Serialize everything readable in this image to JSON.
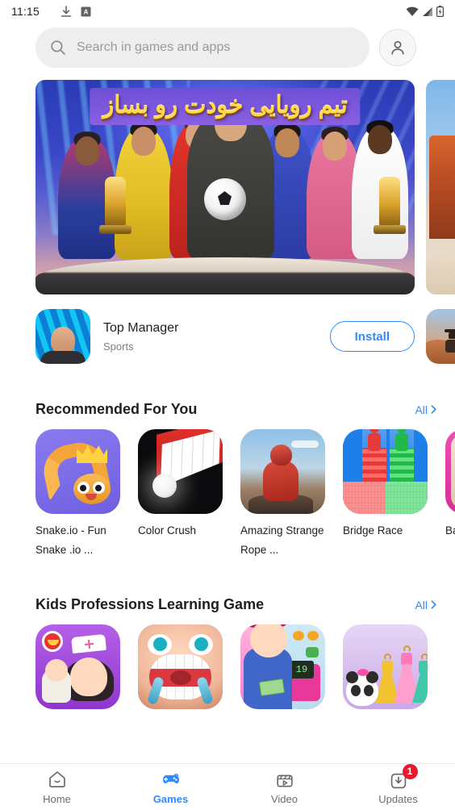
{
  "status_bar": {
    "time": "11:15",
    "left_icons": [
      "download-icon",
      "app-badge-icon"
    ],
    "right_icons": [
      "wifi-icon",
      "signal-icon",
      "battery-icon"
    ]
  },
  "search": {
    "placeholder": "Search in games and apps",
    "icon": "search-icon",
    "avatar_icon": "account-icon"
  },
  "banners": [
    {
      "title": "تیم رویایی خودت رو بساز",
      "theme": "football-dream-team"
    },
    {
      "title": "",
      "theme": "western-canyon"
    }
  ],
  "featured": {
    "icon": "top-manager-icon",
    "title": "Top Manager",
    "category": "Sports",
    "install_label": "Install",
    "peek_icon": "western-game-icon"
  },
  "sections": [
    {
      "title": "Recommended For You",
      "all_label": "All",
      "chevron": "chevron-right-icon",
      "apps": [
        {
          "name": "Snake.io - Fun Snake .io ...",
          "icon": "snake-io-icon"
        },
        {
          "name": "Color Crush",
          "icon": "color-crush-icon"
        },
        {
          "name": "Amazing Strange Rope ...",
          "icon": "amazing-strange-rope-icon"
        },
        {
          "name": "Bridge Race",
          "icon": "bridge-race-icon"
        },
        {
          "name": "Baghali",
          "icon": "baghali-icon"
        }
      ]
    },
    {
      "title": "Kids Professions Learning Game",
      "all_label": "All",
      "chevron": "chevron-right-icon",
      "apps": [
        {
          "name": "",
          "icon": "baby-nurse-icon"
        },
        {
          "name": "",
          "icon": "kids-dentist-icon"
        },
        {
          "name": "",
          "icon": "supermarket-girl-icon"
        },
        {
          "name": "",
          "icon": "panda-dress-up-icon"
        }
      ]
    }
  ],
  "bottom_nav": {
    "items": [
      {
        "label": "Home",
        "icon": "home-icon",
        "active": false,
        "badge": ""
      },
      {
        "label": "Games",
        "icon": "gamepad-icon",
        "active": true,
        "badge": ""
      },
      {
        "label": "Video",
        "icon": "video-icon",
        "active": false,
        "badge": ""
      },
      {
        "label": "Updates",
        "icon": "download-box-icon",
        "active": false,
        "badge": "1"
      }
    ]
  },
  "colors": {
    "accent": "#2f8bff",
    "badge": "#e8192c",
    "text": "#1f1f1f",
    "muted": "#808080",
    "search_bg": "#eeeeee"
  },
  "market_register_display": "19"
}
